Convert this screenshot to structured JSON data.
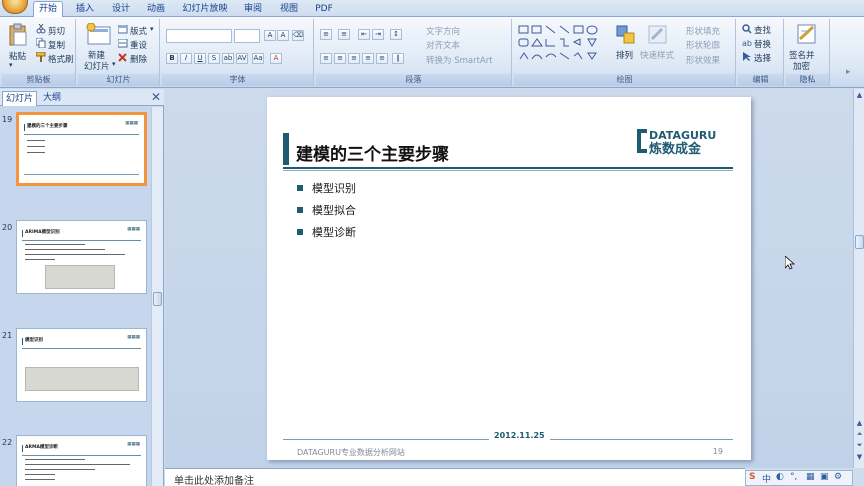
{
  "ribbon_tabs": [
    "开始",
    "插入",
    "设计",
    "动画",
    "幻灯片放映",
    "审阅",
    "视图",
    "PDF"
  ],
  "active_tab": "开始",
  "clipboard": {
    "paste": "粘贴",
    "cut": "剪切",
    "copy": "复制",
    "format_painter": "格式刷",
    "label": "剪贴板"
  },
  "slides_group": {
    "new_slide": "新建",
    "new_slide2": "幻灯片",
    "layout": "版式",
    "reset": "重设",
    "delete": "删除",
    "label": "幻灯片"
  },
  "font_group": {
    "label": "字体"
  },
  "paragraph_group": {
    "text_direction": "文字方向",
    "align_text": "对齐文本",
    "smartart": "转换为 SmartArt",
    "label": "段落"
  },
  "drawing_group": {
    "arrange": "排列",
    "quick_styles": "快速样式",
    "shape_fill": "形状填充",
    "shape_outline": "形状轮廓",
    "shape_effects": "形状效果",
    "label": "绘图"
  },
  "editing_group": {
    "find": "查找",
    "replace": "替换",
    "select": "选择",
    "label": "编辑"
  },
  "privacy_group": {
    "sign": "签名并",
    "encrypt": "加密",
    "label": "隐私"
  },
  "pane_tabs": [
    "幻灯片",
    "大纲"
  ],
  "thumbnails": [
    {
      "number": "19",
      "title": "建模的三个主要步骤"
    },
    {
      "number": "20",
      "title": "ARIMA模型识别"
    },
    {
      "number": "21",
      "title": "模型识别"
    },
    {
      "number": "22",
      "title": "ARMA模型诊断"
    }
  ],
  "slide": {
    "title": "建模的三个主要步骤",
    "logo_top": "DATAGURU",
    "logo_bottom": "炼数成金",
    "bullets": [
      "模型识别",
      "模型拟合",
      "模型诊断"
    ],
    "date": "2012.11.25",
    "footer": "DATAGURU专业数据分析网站",
    "page": "19"
  },
  "notes_placeholder": "单击此处添加备注",
  "colors": {
    "accent": "#1f5b73",
    "selection": "#f2953c"
  }
}
